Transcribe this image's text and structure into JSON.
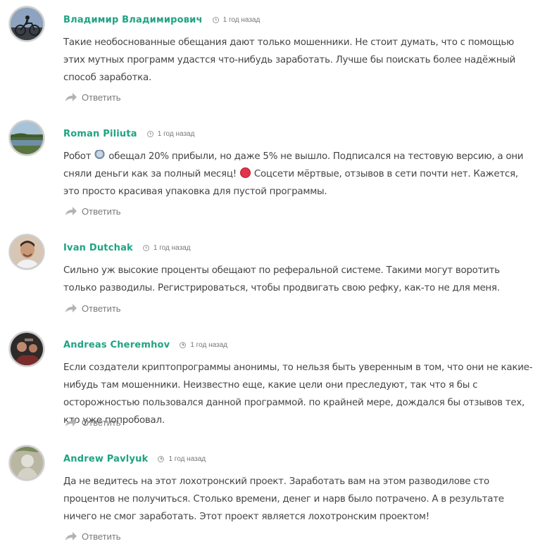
{
  "comments": [
    {
      "author": "Владимир Владимирович",
      "time": "1 год назад",
      "text": "Такие необоснованные обещания дают только мошенники. Не стоит думать, что с помощью этих мутных программ удастся что-нибудь заработать. Лучше бы поискать более надёжный способ заработка.",
      "reply": "Ответить",
      "avatar": "cyclist-avatar"
    },
    {
      "author": "Roman Piliuta",
      "time": "1 год назад",
      "text_1": "Робот ",
      "text_2": " обещал 20% прибыли, но даже 5% не вышло. Подписался на тестовую версию, а они сняли деньги как за полный месяц! ",
      "text_3": " Соцсети мёртвые, отзывов в сети почти нет. Кажется, это просто красивая упаковка для пустой программы.",
      "emoji_1": "robot-emoji",
      "emoji_2": "angry-face-emoji",
      "reply": "Ответить",
      "avatar": "landscape-avatar"
    },
    {
      "author": "Ivan Dutchak",
      "time": "1 год назад",
      "text": "Сильно уж высокие проценты обещают по реферальной системе. Такими могут воротить только разводилы. Регистрироваться, чтобы продвигать свою рефку, как-то не для меня.",
      "reply": "Ответить",
      "avatar": "portrait-avatar"
    },
    {
      "author": "Andreas Cheremhov",
      "time": "1 год назад",
      "text": "Если создатели криптопрограммы анонимы, то нельзя быть уверенным в том, что они не какие-нибудь там мошенники. Неизвестно еще, какие цели они преследуют, так что я бы с осторожностью пользовался данной программой. по крайней мере, дождался бы отзывов тех, кто уже попробовал.",
      "reply": "Ответить",
      "avatar": "group-photo-avatar"
    },
    {
      "author": "Andrew Pavlyuk",
      "time": "1 год назад",
      "text": "Да не ведитесь на этот лохотронский проект. Заработать вам на этом разводилове сто процентов не получиться. Столько времени, денег и нарв было потрачено. А в результате ничего не смог заработать. Этот проект является лохотронским проектом!",
      "reply": "Ответить",
      "avatar": "outdoor-avatar"
    }
  ],
  "colors": {
    "author": "#1fa383",
    "text": "#444444",
    "meta": "#777777"
  }
}
